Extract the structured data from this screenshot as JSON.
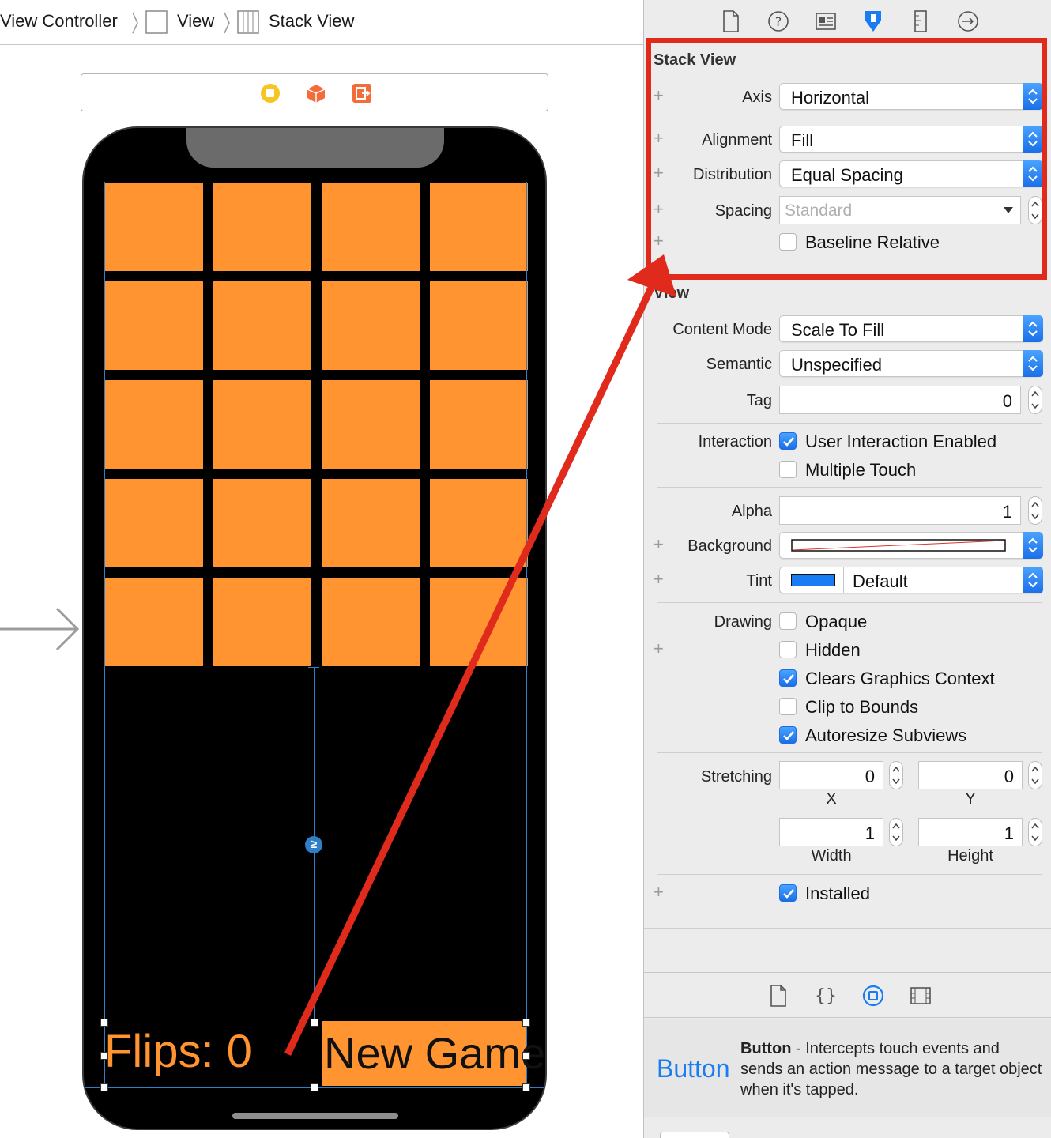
{
  "breadcrumb": {
    "items": [
      {
        "label": "View Controller"
      },
      {
        "label": "View"
      },
      {
        "label": "Stack View"
      }
    ]
  },
  "canvas": {
    "flips_label": "Flips: 0",
    "new_game_label": "New Game",
    "constraint_badge": "≥",
    "card_color": "#ff9431",
    "card_rows": 5,
    "card_columns": 4
  },
  "inspector": {
    "tabs": [
      "file-icon",
      "help-icon",
      "identity-icon",
      "attributes-icon",
      "size-icon",
      "connections-icon"
    ],
    "stack_view": {
      "header": "Stack View",
      "axis_label": "Axis",
      "axis_value": "Horizontal",
      "alignment_label": "Alignment",
      "alignment_value": "Fill",
      "distribution_label": "Distribution",
      "distribution_value": "Equal Spacing",
      "spacing_label": "Spacing",
      "spacing_placeholder": "Standard",
      "baseline_label": "Baseline Relative",
      "baseline_checked": false
    },
    "view": {
      "header": "View",
      "content_mode_label": "Content Mode",
      "content_mode_value": "Scale To Fill",
      "semantic_label": "Semantic",
      "semantic_value": "Unspecified",
      "tag_label": "Tag",
      "tag_value": "0",
      "interaction_label": "Interaction",
      "user_interaction_label": "User Interaction Enabled",
      "user_interaction_checked": true,
      "multiple_touch_label": "Multiple Touch",
      "multiple_touch_checked": false,
      "alpha_label": "Alpha",
      "alpha_value": "1",
      "background_label": "Background",
      "tint_label": "Tint",
      "tint_value": "Default",
      "tint_color": "#1a7cf2",
      "drawing_label": "Drawing",
      "opaque_label": "Opaque",
      "opaque_checked": false,
      "hidden_label": "Hidden",
      "hidden_checked": false,
      "clears_label": "Clears Graphics Context",
      "clears_checked": true,
      "clip_label": "Clip to Bounds",
      "clip_checked": false,
      "autoresize_label": "Autoresize Subviews",
      "autoresize_checked": true,
      "stretching_label": "Stretching",
      "stretch_x": "0",
      "stretch_y": "0",
      "stretch_x_label": "X",
      "stretch_y_label": "Y",
      "stretch_width": "1",
      "stretch_height": "1",
      "stretch_width_label": "Width",
      "stretch_height_label": "Height",
      "installed_label": "Installed",
      "installed_checked": true
    },
    "library_tabs": [
      "file-template-icon",
      "code-snippet-icon",
      "object-library-icon",
      "media-library-icon"
    ],
    "library_item": {
      "icon_text": "Button",
      "title": "Button",
      "description": " - Intercepts touch events and sends an action message to a target object when it's tapped."
    }
  },
  "annotation": {
    "highlight_color": "#e02a1c"
  }
}
